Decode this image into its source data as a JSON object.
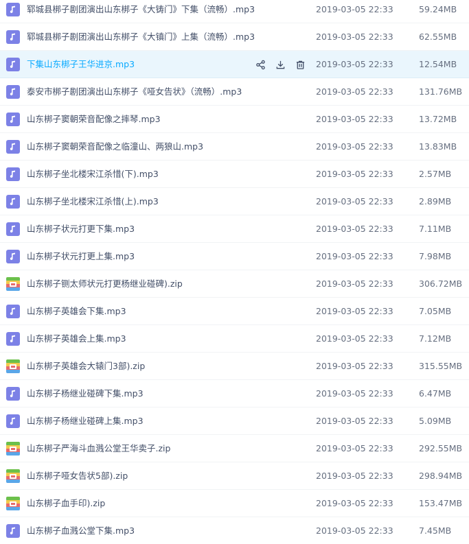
{
  "colors": {
    "audio_icon_bg": "#7c81e6",
    "highlight_bg": "#eaf6fd",
    "highlight_text": "#09aaff",
    "name_text": "#424e67",
    "meta_text": "#666f80"
  },
  "files": [
    {
      "name": "郓城县梆子剧团演出山东梆子《大铸门》下集（流畅）.mp3",
      "date": "2019-03-05 22:33",
      "size": "59.24MB",
      "type": "audio",
      "icon": "music-note-icon"
    },
    {
      "name": "郓城县梆子剧团演出山东梆子《大镇门》上集（流畅）.mp3",
      "date": "2019-03-05 22:33",
      "size": "62.55MB",
      "type": "audio",
      "icon": "music-note-icon"
    },
    {
      "name": "下集山东梆子王华进京.mp3",
      "date": "2019-03-05 22:33",
      "size": "12.54MB",
      "type": "audio",
      "icon": "music-note-icon",
      "highlighted": true
    },
    {
      "name": "泰安市梆子剧团演出山东梆子《哑女告状》（流畅）.mp3",
      "date": "2019-03-05 22:33",
      "size": "131.76MB",
      "type": "audio",
      "icon": "music-note-icon"
    },
    {
      "name": "山东梆子窦朝荣音配像之摔琴.mp3",
      "date": "2019-03-05 22:33",
      "size": "13.72MB",
      "type": "audio",
      "icon": "music-note-icon"
    },
    {
      "name": "山东梆子窦朝荣音配像之临潼山、两狼山.mp3",
      "date": "2019-03-05 22:33",
      "size": "13.83MB",
      "type": "audio",
      "icon": "music-note-icon"
    },
    {
      "name": "山东梆子坐北楼宋江杀惜(下).mp3",
      "date": "2019-03-05 22:33",
      "size": "2.57MB",
      "type": "audio",
      "icon": "music-note-icon"
    },
    {
      "name": "山东梆子坐北楼宋江杀惜(上).mp3",
      "date": "2019-03-05 22:33",
      "size": "2.89MB",
      "type": "audio",
      "icon": "music-note-icon"
    },
    {
      "name": "山东梆子状元打更下集.mp3",
      "date": "2019-03-05 22:33",
      "size": "7.11MB",
      "type": "audio",
      "icon": "music-note-icon"
    },
    {
      "name": "山东梆子状元打更上集.mp3",
      "date": "2019-03-05 22:33",
      "size": "7.98MB",
      "type": "audio",
      "icon": "music-note-icon"
    },
    {
      "name": "山东梆子铡太师状元打更杨继业碰碑).zip",
      "date": "2019-03-05 22:33",
      "size": "306.72MB",
      "type": "archive",
      "icon": "zip-archive-icon"
    },
    {
      "name": "山东梆子英雄会下集.mp3",
      "date": "2019-03-05 22:33",
      "size": "7.05MB",
      "type": "audio",
      "icon": "music-note-icon"
    },
    {
      "name": "山东梆子英雄会上集.mp3",
      "date": "2019-03-05 22:33",
      "size": "7.12MB",
      "type": "audio",
      "icon": "music-note-icon"
    },
    {
      "name": "山东梆子英雄会大辕门3部).zip",
      "date": "2019-03-05 22:33",
      "size": "315.55MB",
      "type": "archive",
      "icon": "zip-archive-icon"
    },
    {
      "name": "山东梆子杨继业碰碑下集.mp3",
      "date": "2019-03-05 22:33",
      "size": "6.47MB",
      "type": "audio",
      "icon": "music-note-icon"
    },
    {
      "name": "山东梆子杨继业碰碑上集.mp3",
      "date": "2019-03-05 22:33",
      "size": "5.09MB",
      "type": "audio",
      "icon": "music-note-icon"
    },
    {
      "name": "山东梆子严海斗血溅公堂王华卖子.zip",
      "date": "2019-03-05 22:33",
      "size": "292.55MB",
      "type": "archive",
      "icon": "zip-archive-icon"
    },
    {
      "name": "山东梆子哑女告状5部).zip",
      "date": "2019-03-05 22:33",
      "size": "298.94MB",
      "type": "archive",
      "icon": "zip-archive-icon"
    },
    {
      "name": "山东梆子血手印).zip",
      "date": "2019-03-05 22:33",
      "size": "153.47MB",
      "type": "archive",
      "icon": "zip-archive-icon"
    },
    {
      "name": "山东梆子血溅公堂下集.mp3",
      "date": "2019-03-05 22:33",
      "size": "7.45MB",
      "type": "audio",
      "icon": "music-note-icon"
    }
  ],
  "row_actions": [
    {
      "icon": "share-icon"
    },
    {
      "icon": "download-icon"
    },
    {
      "icon": "delete-icon"
    }
  ]
}
